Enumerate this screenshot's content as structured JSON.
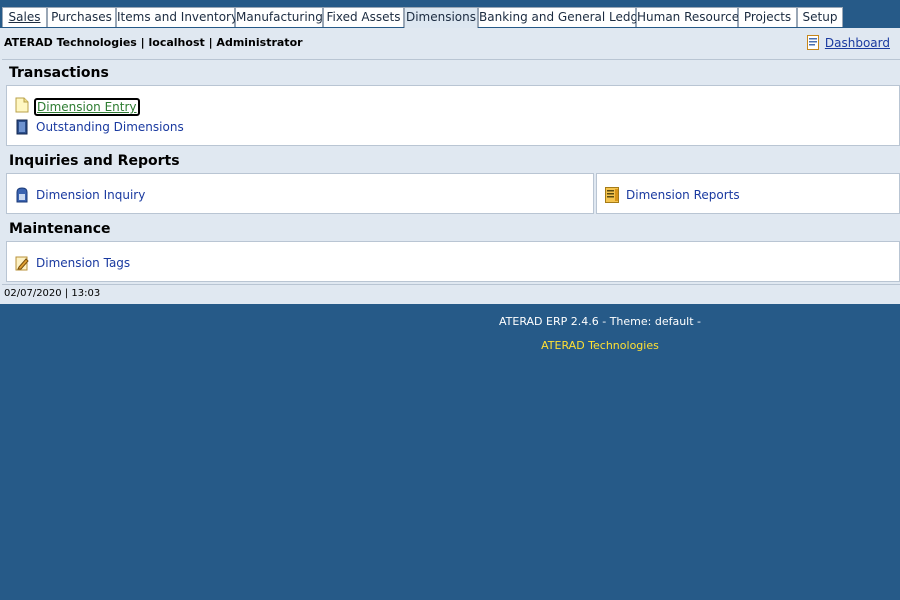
{
  "tabs": [
    {
      "label": "Sales"
    },
    {
      "label": "Purchases"
    },
    {
      "label": "Items and Inventory"
    },
    {
      "label": "Manufacturing"
    },
    {
      "label": "Fixed Assets"
    },
    {
      "label": "Dimensions"
    },
    {
      "label": "Banking and General Ledger"
    },
    {
      "label": "Human Resource"
    },
    {
      "label": "Projects"
    },
    {
      "label": "Setup"
    }
  ],
  "header": {
    "info": "ATERAD Technologies | localhost | Administrator",
    "dashboard_label": "Dashboard"
  },
  "transactions": {
    "title": "Transactions",
    "items": [
      {
        "label": "Dimension Entry",
        "icon": "note-icon"
      },
      {
        "label": "Outstanding Dimensions",
        "icon": "book-icon"
      }
    ]
  },
  "inquiries": {
    "title": "Inquiries and Reports",
    "left": {
      "label": "Dimension Inquiry",
      "icon": "inquiry-icon"
    },
    "right": {
      "label": "Dimension Reports",
      "icon": "report-icon"
    }
  },
  "maintenance": {
    "title": "Maintenance",
    "items": [
      {
        "label": "Dimension Tags",
        "icon": "tag-edit-icon"
      }
    ]
  },
  "status": {
    "datetime": "02/07/2020 | 13:03"
  },
  "footer": {
    "version": "ATERAD ERP 2.4.6 - Theme: default -",
    "company": "ATERAD Technologies"
  },
  "colors": {
    "background": "#265a88",
    "panel": "#e0e8f1",
    "link": "#1a3aa0",
    "footer_company": "#ffe033"
  }
}
